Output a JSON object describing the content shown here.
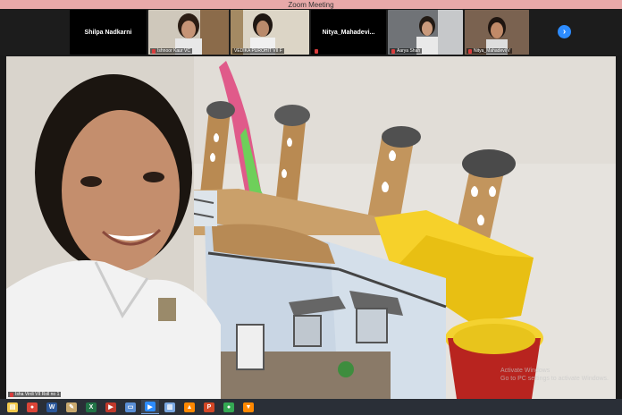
{
  "window": {
    "title": "Zoom Meeting"
  },
  "participants": [
    {
      "name": "Shilpa Nadkarni",
      "video": false,
      "muted": false
    },
    {
      "name": "Ishnoor Kaur VC",
      "video": true,
      "muted": true
    },
    {
      "name": "VEDIKA PUROHIT VII F",
      "video": true,
      "muted": false
    },
    {
      "name": "Nitya_Mahadevi...",
      "video": false,
      "muted": true
    },
    {
      "name": "Aarya Shah",
      "video": true,
      "muted": true
    },
    {
      "name": "Nitya_Mahadevi(V",
      "video": true,
      "muted": true
    }
  ],
  "strip": {
    "next_icon": "chevron-right-icon",
    "next_glyph": "›"
  },
  "main_video": {
    "speaker_tag": "Isha Virdi VII Roll no 1",
    "watermark_line1": "Activate Windows",
    "watermark_line2": "Go to PC settings to activate Windows."
  },
  "taskbar": {
    "icons": [
      {
        "name": "file-explorer-icon",
        "glyph": "▤",
        "color": "#f2c94c"
      },
      {
        "name": "chrome-icon",
        "glyph": "●",
        "color": "#db4437"
      },
      {
        "name": "word-icon",
        "glyph": "W",
        "color": "#2b579a"
      },
      {
        "name": "paint-icon",
        "glyph": "✎",
        "color": "#c9a96e"
      },
      {
        "name": "excel-icon",
        "glyph": "X",
        "color": "#217346"
      },
      {
        "name": "media-icon",
        "glyph": "▶",
        "color": "#c0392b"
      },
      {
        "name": "monitor-icon",
        "glyph": "▭",
        "color": "#5a8fd6"
      },
      {
        "name": "zoom-icon",
        "glyph": "▶",
        "color": "#2d8cff"
      },
      {
        "name": "document-icon",
        "glyph": "▥",
        "color": "#7aa7e0"
      },
      {
        "name": "vlc-icon",
        "glyph": "▲",
        "color": "#ff8800"
      },
      {
        "name": "powerpoint-icon",
        "glyph": "P",
        "color": "#d24726"
      },
      {
        "name": "chrome-2-icon",
        "glyph": "●",
        "color": "#34a853"
      },
      {
        "name": "vlc-2-icon",
        "glyph": "▼",
        "color": "#ff8800"
      }
    ]
  }
}
